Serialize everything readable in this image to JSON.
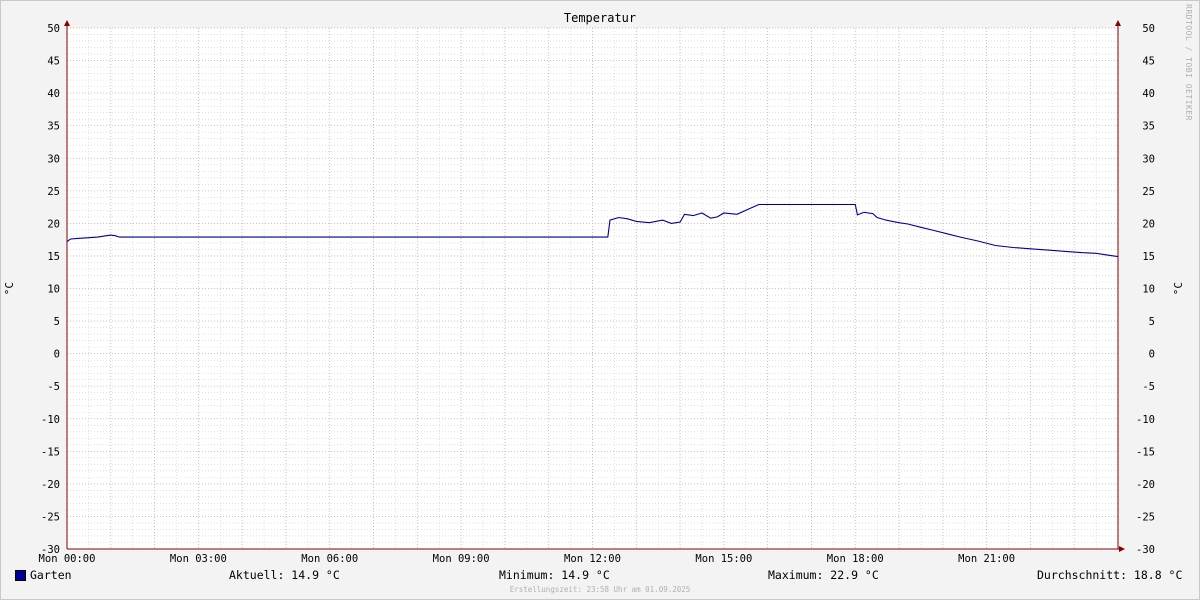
{
  "chart_data": {
    "type": "line",
    "title": "Temperatur",
    "ylabel": "°C",
    "ylabel_right": "°C",
    "ylim": [
      -30,
      50
    ],
    "y_ticks": [
      50,
      45,
      40,
      35,
      30,
      25,
      20,
      15,
      10,
      5,
      0,
      -5,
      -10,
      -15,
      -20,
      -25,
      -30
    ],
    "xlim_hours": [
      0,
      24
    ],
    "x_tick_labels": [
      "Mon 00:00",
      "Mon 03:00",
      "Mon 06:00",
      "Mon 09:00",
      "Mon 12:00",
      "Mon 15:00",
      "Mon 18:00",
      "Mon 21:00"
    ],
    "grid": true,
    "series": [
      {
        "name": "Garten",
        "color": "#000099",
        "x_hours": [
          0,
          0.08,
          0.25,
          0.5,
          0.7,
          0.9,
          1.0,
          1.1,
          1.2,
          2,
          4,
          8,
          10,
          12,
          12.35,
          12.4,
          12.6,
          12.8,
          13.0,
          13.3,
          13.6,
          13.8,
          14.0,
          14.1,
          14.3,
          14.5,
          14.7,
          14.85,
          15.0,
          15.3,
          15.6,
          15.8,
          16,
          17,
          17.5,
          18.0,
          18.05,
          18.2,
          18.4,
          18.5,
          18.7,
          19.0,
          19.2,
          19.5,
          19.8,
          20.1,
          20.4,
          20.8,
          21.2,
          21.6,
          22.0,
          22.4,
          22.8,
          23.2,
          23.5,
          23.8,
          24.0
        ],
        "y_values": [
          17.2,
          17.6,
          17.7,
          17.8,
          17.9,
          18.1,
          18.2,
          18.1,
          17.9,
          17.9,
          17.9,
          17.9,
          17.9,
          17.9,
          17.9,
          20.5,
          20.9,
          20.7,
          20.3,
          20.1,
          20.5,
          20.0,
          20.2,
          21.4,
          21.2,
          21.6,
          20.8,
          21.0,
          21.6,
          21.4,
          22.3,
          22.9,
          22.9,
          22.9,
          22.9,
          22.9,
          21.3,
          21.7,
          21.5,
          20.9,
          20.5,
          20.1,
          19.9,
          19.4,
          18.9,
          18.4,
          17.9,
          17.3,
          16.6,
          16.3,
          16.1,
          15.9,
          15.7,
          15.5,
          15.4,
          15.1,
          14.9
        ]
      }
    ]
  },
  "legend": {
    "series_name": "Garten",
    "current": "Aktuell: 14.9 °C",
    "minimum": "Minimum: 14.9 °C",
    "maximum": "Maximum: 22.9 °C",
    "average": "Durchschnitt: 18.8 °C"
  },
  "watermark": "RRDTOOL / TOBI OETIKER",
  "footer": "Erstellungszeit: 23:58 Uhr am 01.09.2025",
  "colors": {
    "line": "#000099",
    "major_grid": "#e8a0a0",
    "minor_grid": "#cccccc",
    "axis": "#880000",
    "plot_bg": "#ffffff"
  }
}
